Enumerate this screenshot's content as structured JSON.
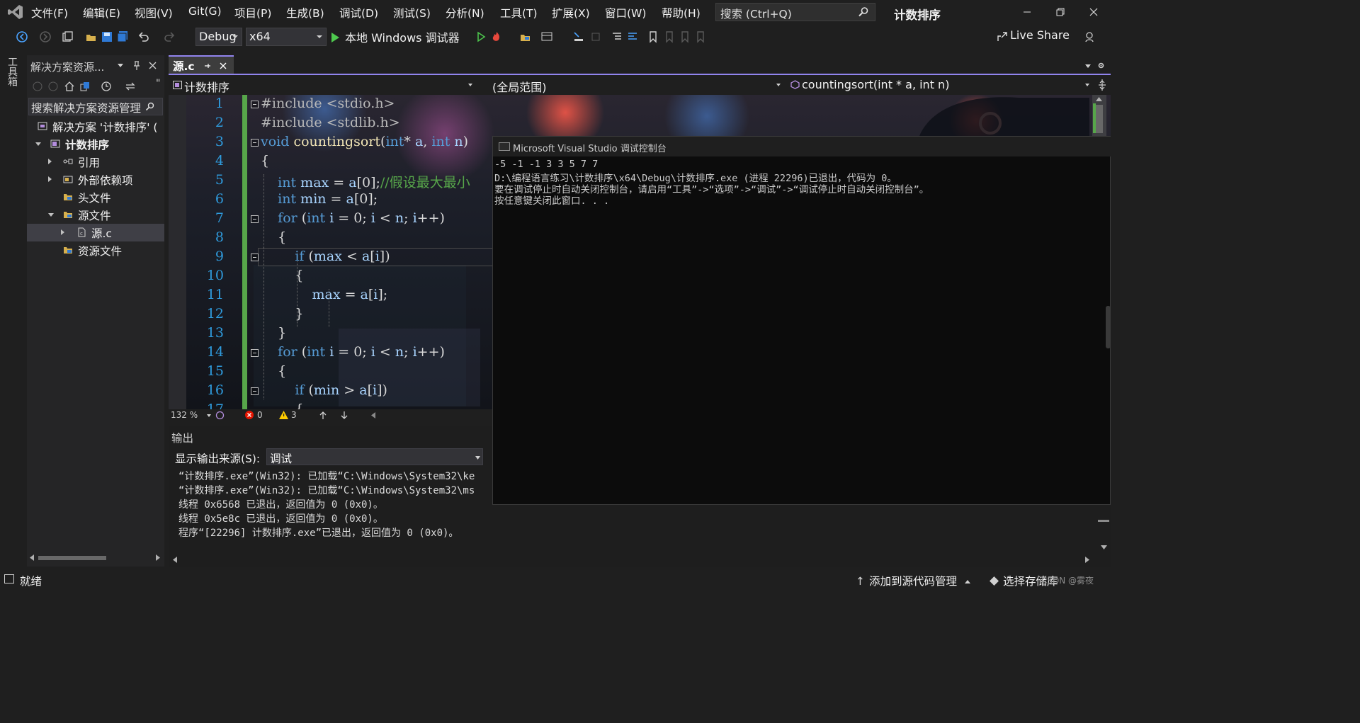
{
  "menu": {
    "items": [
      "文件(F)",
      "编辑(E)",
      "视图(V)",
      "Git(G)",
      "项目(P)",
      "生成(B)",
      "调试(D)",
      "测试(S)",
      "分析(N)",
      "工具(T)",
      "扩展(X)",
      "窗口(W)",
      "帮助(H)"
    ],
    "search_label": "搜索 (Ctrl+Q)",
    "solution_name": "计数排序"
  },
  "toolbar": {
    "config": "Debug",
    "platform": "x64",
    "run_label": "本地 Windows 调试器",
    "live_share": "Live Share"
  },
  "left_strip": {
    "toolbox": "工具箱"
  },
  "solution_explorer": {
    "title": "解决方案资源...",
    "search_placeholder": "搜索解决方案资源管理",
    "items": [
      {
        "label": "解决方案 '计数排序' (",
        "bold": false
      },
      {
        "label": "计数排序",
        "bold": true
      },
      {
        "label": "引用"
      },
      {
        "label": "外部依赖项"
      },
      {
        "label": "头文件"
      },
      {
        "label": "源文件"
      },
      {
        "label": "源.c"
      },
      {
        "label": "资源文件"
      }
    ]
  },
  "doc_tab": {
    "name": "源.c"
  },
  "nav_bar": {
    "project": "计数排序",
    "scope": "(全局范围)",
    "member": "countingsort(int * a, int n)"
  },
  "editor": {
    "line_numbers": [
      "1",
      "2",
      "3",
      "4",
      "5",
      "6",
      "7",
      "8",
      "9",
      "10",
      "11",
      "12",
      "13",
      "14",
      "15",
      "16",
      "17"
    ],
    "zoom": "132 %",
    "errors": "0",
    "warnings": "3"
  },
  "output": {
    "title": "输出",
    "source_label": "显示输出来源(S):",
    "source_value": "调试",
    "lines": [
      "“计数排序.exe”(Win32): 已加载“C:\\Windows\\System32\\ke",
      "“计数排序.exe”(Win32): 已加载“C:\\Windows\\System32\\ms",
      "线程 0x6568 已退出，返回值为 0 (0x0)。",
      "线程 0x5e8c 已退出，返回值为 0 (0x0)。",
      "程序“[22296] 计数排序.exe”已退出，返回值为 0 (0x0)。"
    ]
  },
  "console": {
    "title": "Microsoft Visual Studio 调试控制台",
    "lines": [
      "-5 -1 -1 3 3 5 7 7",
      "D:\\编程语言练习\\计数排序\\x64\\Debug\\计数排序.exe (进程 22296)已退出，代码为 0。",
      "要在调试停止时自动关闭控制台，请启用“工具”->“选项”->“调试”->“调试停止时自动关闭控制台”。",
      "按任意键关闭此窗口. . ."
    ]
  },
  "statusbar": {
    "ready": "就绪",
    "scm": "添加到源代码管理",
    "repo": "选择存储库",
    "watermark": "CSDN @雾夜"
  },
  "colors": {
    "accent": "#9184ee",
    "keyword": "#569cd6",
    "comment": "#57a64a",
    "line_number": "#2f9bdd",
    "run_green": "#4ec94e"
  }
}
